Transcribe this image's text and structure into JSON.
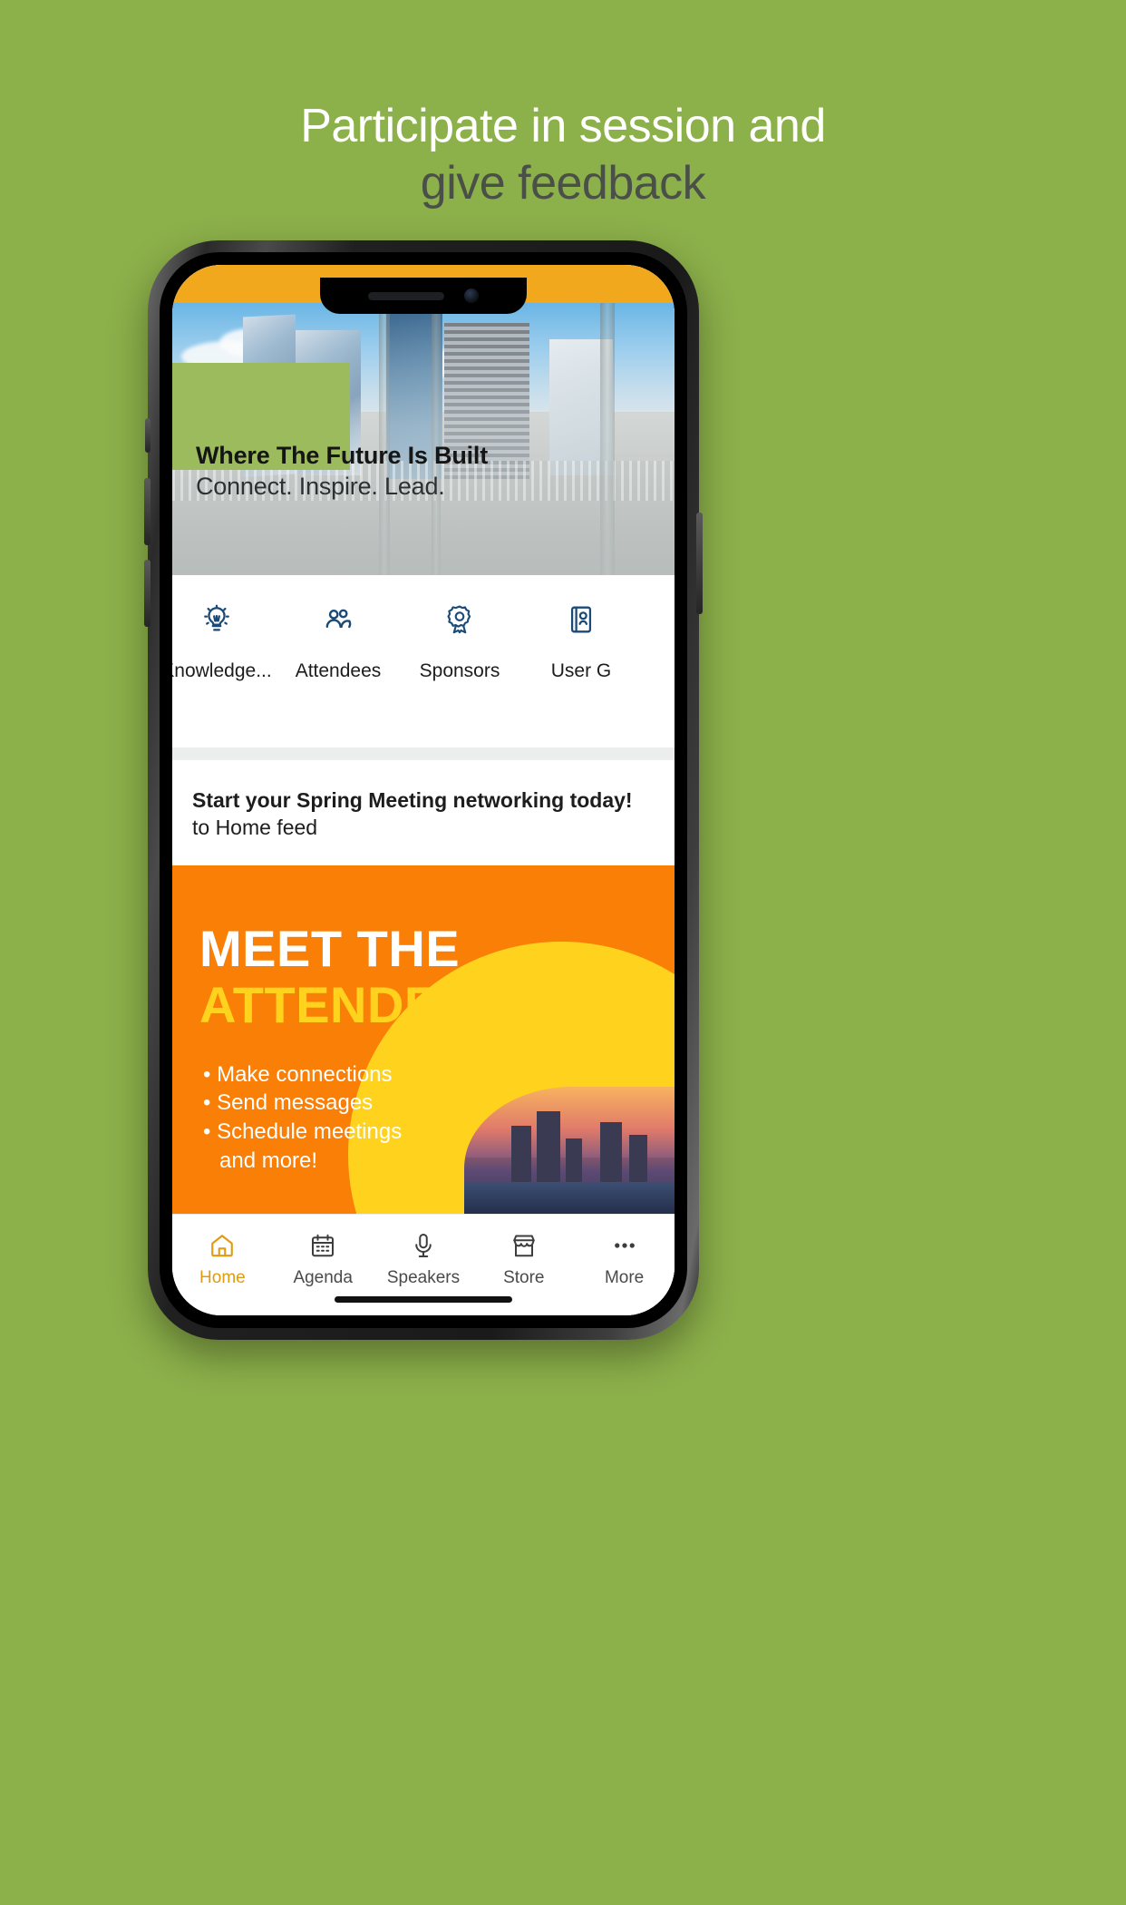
{
  "promo": {
    "line1": "Participate in session and",
    "line2": "give feedback",
    "bg_color": "#8cb04a",
    "line1_color": "#ffffff",
    "line2_color": "#4a4f48"
  },
  "app": {
    "statusbar_color": "#f2a81d",
    "hero": {
      "title": "Where The Future Is Built",
      "subtitle": "Connect. Inspire. Lead."
    },
    "quick_nav": [
      {
        "label": "Knowledge...",
        "icon": "lightbulb-icon"
      },
      {
        "label": "Attendees",
        "icon": "people-icon"
      },
      {
        "label": "Sponsors",
        "icon": "award-ribbon-icon"
      },
      {
        "label": "User G",
        "icon": "guide-book-icon"
      }
    ],
    "quick_nav_icon_color": "#1b4a77",
    "feed": {
      "bold_text": "Start your Spring Meeting networking today!",
      "rest_text": " to Home feed"
    },
    "banner": {
      "headline_top": "MEET THE",
      "headline_bottom": "ATTENDEES",
      "bullets": [
        "Make connections",
        "Send messages",
        "Schedule meetings",
        "and more!"
      ],
      "bg_color": "#f97f07",
      "accent_color": "#ffd21e"
    },
    "tabbar": {
      "active_color": "#e09b10",
      "items": [
        {
          "label": "Home",
          "icon": "home-icon",
          "active": true
        },
        {
          "label": "Agenda",
          "icon": "calendar-icon",
          "active": false
        },
        {
          "label": "Speakers",
          "icon": "microphone-icon",
          "active": false
        },
        {
          "label": "Store",
          "icon": "store-icon",
          "active": false
        },
        {
          "label": "More",
          "icon": "ellipsis-icon",
          "active": false
        }
      ]
    }
  }
}
